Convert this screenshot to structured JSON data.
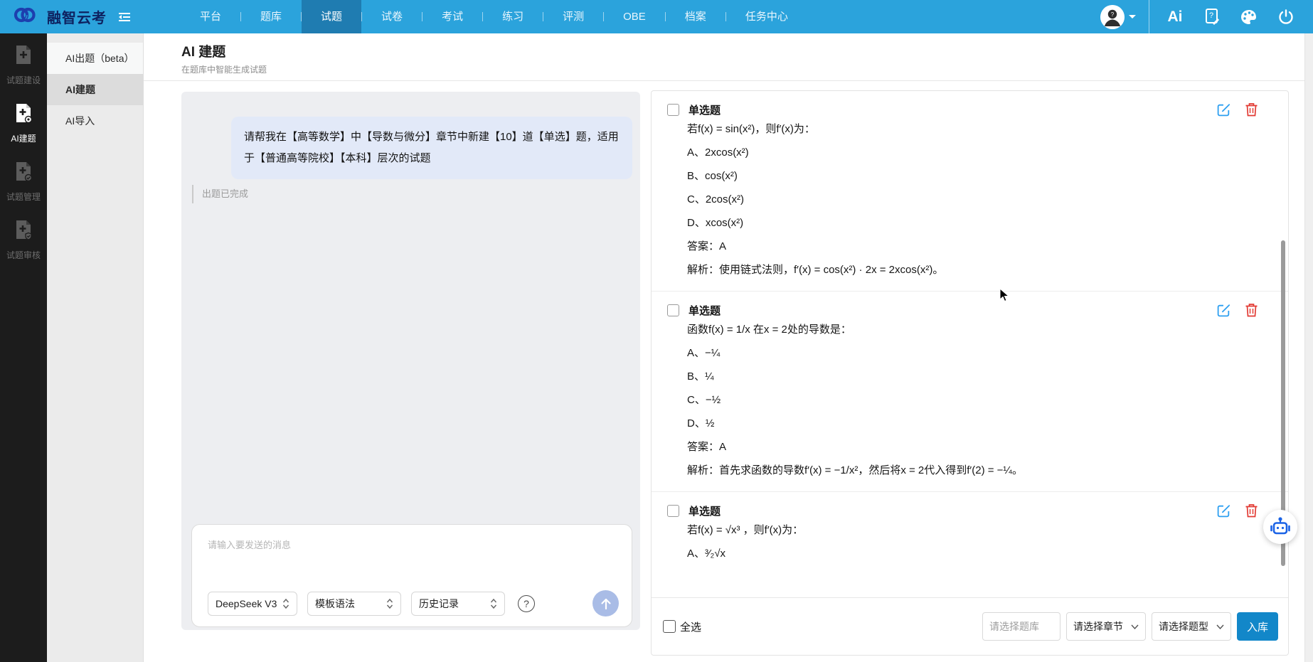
{
  "topbar": {
    "brand": "融智云考",
    "ai_label": "Ai",
    "nav": [
      {
        "label": "平台",
        "active": false
      },
      {
        "label": "题库",
        "active": false
      },
      {
        "label": "试题",
        "active": true
      },
      {
        "label": "试卷",
        "active": false
      },
      {
        "label": "考试",
        "active": false
      },
      {
        "label": "练习",
        "active": false
      },
      {
        "label": "评测",
        "active": false
      },
      {
        "label": "OBE",
        "active": false
      },
      {
        "label": "档案",
        "active": false
      },
      {
        "label": "任务中心",
        "active": false
      }
    ]
  },
  "sidebar": {
    "items": [
      {
        "label": "试题建设",
        "active": false
      },
      {
        "label": "AI建题",
        "active": true
      },
      {
        "label": "试题管理",
        "active": false
      },
      {
        "label": "试题审核",
        "active": false
      }
    ]
  },
  "submenu": {
    "items": [
      {
        "label": "AI出题（beta）",
        "active": false
      },
      {
        "label": "AI建题",
        "active": true
      },
      {
        "label": "AI导入",
        "active": false
      }
    ]
  },
  "header": {
    "title": "AI 建题",
    "subtitle": "在题库中智能生成试题"
  },
  "chat": {
    "user_message": "请帮我在【高等数学】中【导数与微分】章节中新建【10】道【单选】题，适用于【普通高等院校】【本科】层次的试题",
    "status": "出题已完成",
    "input_placeholder": "请输入要发送的消息",
    "model_select": "DeepSeek V3",
    "template_select": "模板语法",
    "history_select": "历史记录"
  },
  "questions": [
    {
      "type": "单选题",
      "stem": "若f(x) = sin(x²)，则f′(x)为：",
      "options": [
        "A、2xcos(x²)",
        "B、cos(x²)",
        "C、2cos(x²)",
        "D、xcos(x²)"
      ],
      "answer": "答案：A",
      "analysis": "解析：使用链式法则，f′(x) = cos(x²) · 2x = 2xcos(x²)。"
    },
    {
      "type": "单选题",
      "stem": "函数f(x) = 1/x 在x = 2处的导数是：",
      "options": [
        "A、−¼",
        "B、¼",
        "C、−½",
        "D、½"
      ],
      "answer": "答案：A",
      "analysis": "解析：首先求函数的导数f′(x) = −1/x²，然后将x = 2代入得到f′(2) = −¼。"
    },
    {
      "type": "单选题",
      "stem": "若f(x) = √x³ ，则f′(x)为：",
      "options": [
        "A、³⁄₂√x"
      ],
      "answer": "",
      "analysis": ""
    }
  ],
  "footer": {
    "select_all": "全选",
    "bank_placeholder": "请选择题库",
    "chapter_placeholder": "请选择章节",
    "qtype_placeholder": "请选择题型",
    "submit": "入库"
  },
  "colors": {
    "topbar": "#2ba3dc",
    "topbar_active": "#1f7cb1",
    "logo_navy": "#1d3fae",
    "edit_icon": "#2d9ff0",
    "delete_icon": "#e23a33",
    "robot_blue": "#1b63e6",
    "submit_button": "#1287c9",
    "send_button": "#a9bce6"
  }
}
